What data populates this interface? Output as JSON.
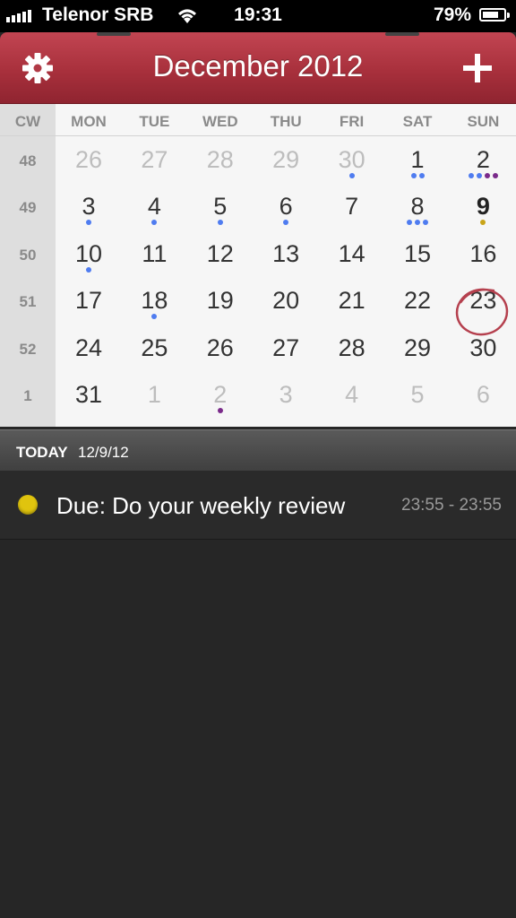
{
  "status_bar": {
    "carrier": "Telenor SRB",
    "time": "19:31",
    "battery": "79%",
    "battery_level": 0.79
  },
  "header": {
    "title": "December 2012",
    "settings_icon": "gear-icon",
    "add_icon": "plus-icon"
  },
  "calendar": {
    "day_headers": [
      "CW",
      "MON",
      "TUE",
      "WED",
      "THU",
      "FRI",
      "SAT",
      "SUN"
    ],
    "dot_colors": {
      "blue": "#4f7cf0",
      "purple": "#7a2a8a",
      "gold": "#c9a418"
    },
    "weeks": [
      {
        "cw": "48",
        "days": [
          {
            "d": "26",
            "dim": true,
            "dots": []
          },
          {
            "d": "27",
            "dim": true,
            "dots": []
          },
          {
            "d": "28",
            "dim": true,
            "dots": []
          },
          {
            "d": "29",
            "dim": true,
            "dots": []
          },
          {
            "d": "30",
            "dim": true,
            "dots": [
              "blue"
            ]
          },
          {
            "d": "1",
            "dim": false,
            "dots": [
              "blue",
              "blue"
            ]
          },
          {
            "d": "2",
            "dim": false,
            "dots": [
              "blue",
              "blue",
              "purple",
              "purple"
            ]
          }
        ]
      },
      {
        "cw": "49",
        "days": [
          {
            "d": "3",
            "dim": false,
            "dots": [
              "blue"
            ]
          },
          {
            "d": "4",
            "dim": false,
            "dots": [
              "blue"
            ]
          },
          {
            "d": "5",
            "dim": false,
            "dots": [
              "blue"
            ]
          },
          {
            "d": "6",
            "dim": false,
            "dots": [
              "blue"
            ]
          },
          {
            "d": "7",
            "dim": false,
            "dots": []
          },
          {
            "d": "8",
            "dim": false,
            "dots": [
              "blue",
              "blue",
              "blue"
            ]
          },
          {
            "d": "9",
            "dim": false,
            "today": true,
            "dots": [
              "gold"
            ]
          }
        ]
      },
      {
        "cw": "50",
        "days": [
          {
            "d": "10",
            "dim": false,
            "dots": [
              "blue"
            ]
          },
          {
            "d": "11",
            "dim": false,
            "dots": []
          },
          {
            "d": "12",
            "dim": false,
            "dots": []
          },
          {
            "d": "13",
            "dim": false,
            "dots": []
          },
          {
            "d": "14",
            "dim": false,
            "dots": []
          },
          {
            "d": "15",
            "dim": false,
            "dots": []
          },
          {
            "d": "16",
            "dim": false,
            "dots": []
          }
        ]
      },
      {
        "cw": "51",
        "days": [
          {
            "d": "17",
            "dim": false,
            "dots": []
          },
          {
            "d": "18",
            "dim": false,
            "dots": [
              "blue"
            ]
          },
          {
            "d": "19",
            "dim": false,
            "dots": []
          },
          {
            "d": "20",
            "dim": false,
            "dots": []
          },
          {
            "d": "21",
            "dim": false,
            "dots": []
          },
          {
            "d": "22",
            "dim": false,
            "dots": []
          },
          {
            "d": "23",
            "dim": false,
            "dots": []
          }
        ]
      },
      {
        "cw": "52",
        "days": [
          {
            "d": "24",
            "dim": false,
            "dots": []
          },
          {
            "d": "25",
            "dim": false,
            "dots": []
          },
          {
            "d": "26",
            "dim": false,
            "dots": []
          },
          {
            "d": "27",
            "dim": false,
            "dots": []
          },
          {
            "d": "28",
            "dim": false,
            "dots": []
          },
          {
            "d": "29",
            "dim": false,
            "dots": []
          },
          {
            "d": "30",
            "dim": false,
            "dots": []
          }
        ]
      },
      {
        "cw": "1",
        "days": [
          {
            "d": "31",
            "dim": false,
            "dots": []
          },
          {
            "d": "1",
            "dim": true,
            "dots": []
          },
          {
            "d": "2",
            "dim": true,
            "dots": [
              "purple"
            ]
          },
          {
            "d": "3",
            "dim": true,
            "dots": []
          },
          {
            "d": "4",
            "dim": true,
            "dots": []
          },
          {
            "d": "5",
            "dim": true,
            "dots": []
          },
          {
            "d": "6",
            "dim": true,
            "dots": []
          }
        ]
      }
    ]
  },
  "today_bar": {
    "label": "TODAY",
    "date": "12/9/12"
  },
  "events": [
    {
      "title": "Due: Do your weekly review",
      "time": "23:55 - 23:55",
      "color": "#e0c40e"
    }
  ]
}
